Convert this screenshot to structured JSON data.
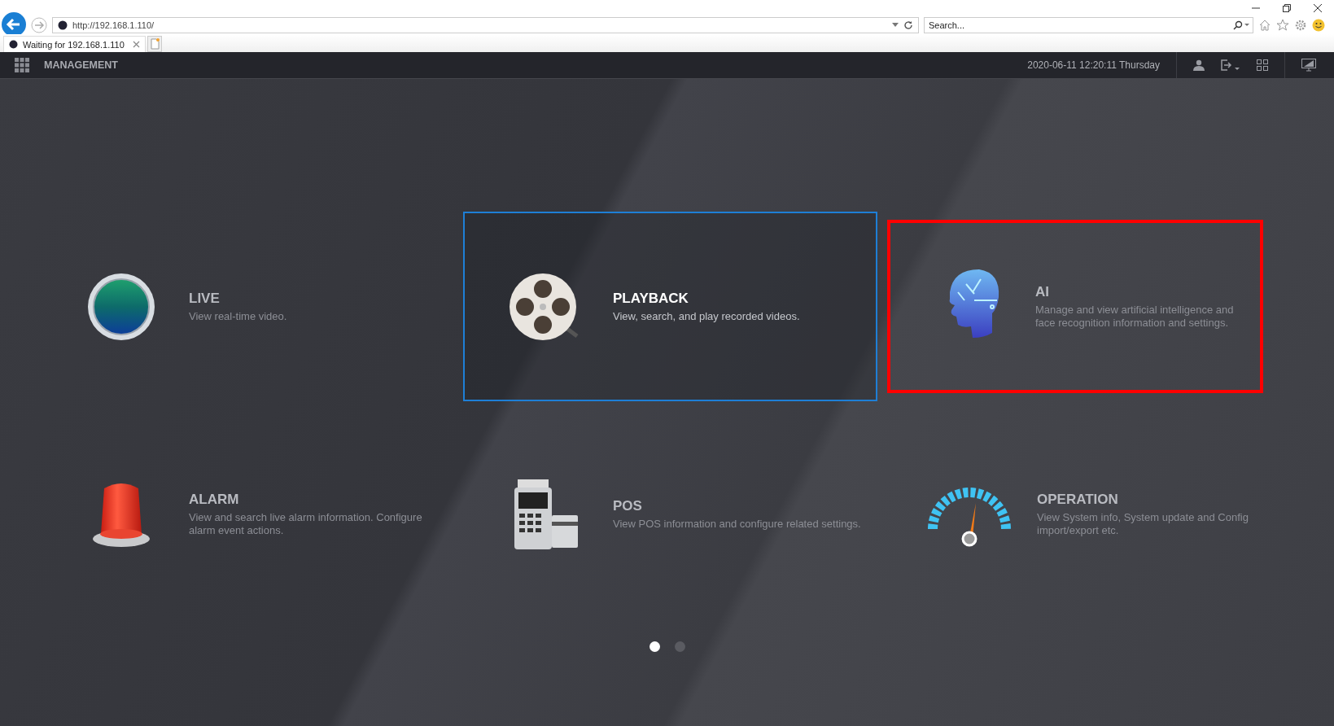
{
  "browser": {
    "url": "http://192.168.1.110/",
    "search": {
      "placeholder": "Search..."
    },
    "tabs": [
      {
        "label": "Waiting for 192.168.1.110",
        "selected": true
      }
    ]
  },
  "header": {
    "title": "MANAGEMENT",
    "datetime": "2020-06-11 12:20:11 Thursday"
  },
  "tiles": [
    {
      "kind": "live",
      "title": "LIVE",
      "description": "View real-time video.",
      "selected": false,
      "highlighted": false
    },
    {
      "kind": "playback",
      "title": "PLAYBACK",
      "description": "View, search, and play recorded videos.",
      "selected": true,
      "highlighted": false
    },
    {
      "kind": "ai",
      "title": "AI",
      "description": "Manage and view artificial intelligence and face recognition information and settings.",
      "selected": false,
      "highlighted": true
    },
    {
      "kind": "alarm",
      "title": "ALARM",
      "description": "View and search live alarm information. Configure alarm event actions.",
      "selected": false,
      "highlighted": false
    },
    {
      "kind": "pos",
      "title": "POS",
      "description": "View POS information and configure related settings.",
      "selected": false,
      "highlighted": false
    },
    {
      "kind": "operation",
      "title": "OPERATION",
      "description": "View System info, System update and Config import/export etc.",
      "selected": false,
      "highlighted": false
    }
  ],
  "pages": [
    {
      "selected": true
    },
    {
      "selected": false
    }
  ]
}
